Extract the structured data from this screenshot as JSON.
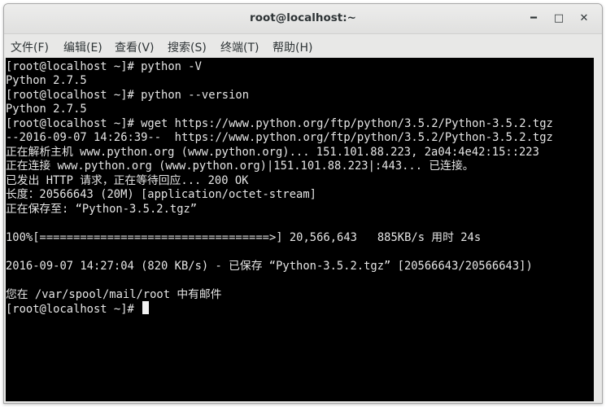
{
  "window": {
    "title": "root@localhost:~",
    "minimize_label": "━",
    "maximize_label": "□",
    "close_label": "✕"
  },
  "menu": {
    "items": [
      "文件(F)",
      "编辑(E)",
      "查看(V)",
      "搜索(S)",
      "终端(T)",
      "帮助(H)"
    ]
  },
  "terminal": {
    "lines": [
      "[root@localhost ~]# python -V",
      "Python 2.7.5",
      "[root@localhost ~]# python --version",
      "Python 2.7.5",
      "[root@localhost ~]# wget https://www.python.org/ftp/python/3.5.2/Python-3.5.2.tgz",
      "--2016-09-07 14:26:39--  https://www.python.org/ftp/python/3.5.2/Python-3.5.2.tgz",
      "正在解析主机 www.python.org (www.python.org)... 151.101.88.223, 2a04:4e42:15::223",
      "正在连接 www.python.org (www.python.org)|151.101.88.223|:443... 已连接。",
      "已发出 HTTP 请求，正在等待回应... 200 OK",
      "长度：20566643 (20M) [application/octet-stream]",
      "正在保存至: “Python-3.5.2.tgz”",
      "",
      "100%[==================================>] 20,566,643   885KB/s 用时 24s",
      "",
      "2016-09-07 14:27:04 (820 KB/s) - 已保存 “Python-3.5.2.tgz” [20566643/20566643])",
      "",
      "您在 /var/spool/mail/root 中有邮件",
      "[root@localhost ~]# "
    ]
  }
}
